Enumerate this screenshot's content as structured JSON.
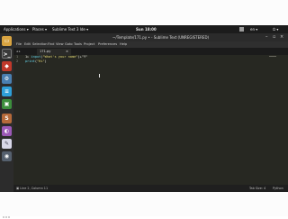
{
  "topbar": {
    "applications": "Applications ▾",
    "places": "Places ▾",
    "app_name": "Sublime Text 3 Ide ▾",
    "clock": "Sun 18:00",
    "lang": "en ▾",
    "power": "⏻ ▾"
  },
  "window": {
    "title": "~/Template/171.py • - Sublime Text (UNREGISTERED)",
    "min": "–",
    "max": "▫",
    "close": "×"
  },
  "menu": [
    "File",
    "Edit",
    "Selection",
    "Find",
    "View",
    "Goto",
    "Tools",
    "Project",
    "Preferences",
    "Help"
  ],
  "tab": {
    "arrows": "◂ ▸",
    "label": "171.py",
    "close": "×"
  },
  "editor": {
    "lines": [
      "1",
      "2"
    ],
    "line1": {
      "prefix": "1▸ ",
      "kw": "input",
      "mid": "(",
      "str": "\"What's your name\"",
      "rest": ")+\"Y\""
    },
    "line2": {
      "prefix": "",
      "kw": "print",
      "mid": "(",
      "str": "\"Hi\"",
      "rest": ")"
    }
  },
  "status": {
    "left": "▣  Line 2, Column 11",
    "tab_size": "Tab Size: 4",
    "syntax": "Python"
  },
  "colors": {
    "editor_bg": "#272822",
    "topbar_bg": "#1c1c1c",
    "dock_bg": "#2c2c2c"
  }
}
